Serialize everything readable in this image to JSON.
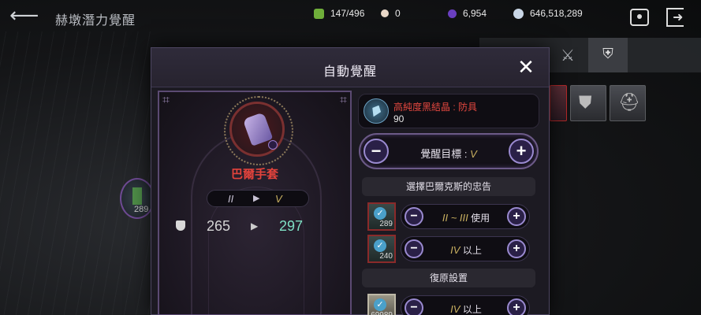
{
  "topbar": {
    "title": "赫墩潛力覺醒",
    "resources": {
      "ore": "147/496",
      "pearl": "0",
      "crystal": "6,954",
      "silver": "646,518,289"
    }
  },
  "background": {
    "left_item_count": "289"
  },
  "modal": {
    "title": "自動覺醒",
    "item": {
      "name": "巴爾手套",
      "grade_from": "II",
      "grade_arrow": "▶",
      "grade_to": "V",
      "stat_from": "265",
      "stat_arrow": "▶",
      "stat_to": "297"
    },
    "material": {
      "name": "高純度黑結晶 : 防具",
      "count": "90"
    },
    "target": {
      "label": "覺醒目標 :",
      "value": "V",
      "minus": "−",
      "plus": "+"
    },
    "advice_header": "選擇巴爾克斯的忠告",
    "restore_header": "復原設置",
    "options": [
      {
        "count": "289",
        "grade": "II  ~  III",
        "text": "使用"
      },
      {
        "count": "240",
        "grade": "IV",
        "text": "以上"
      },
      {
        "count": "69989",
        "grade": "IV",
        "text": "以上"
      }
    ]
  }
}
